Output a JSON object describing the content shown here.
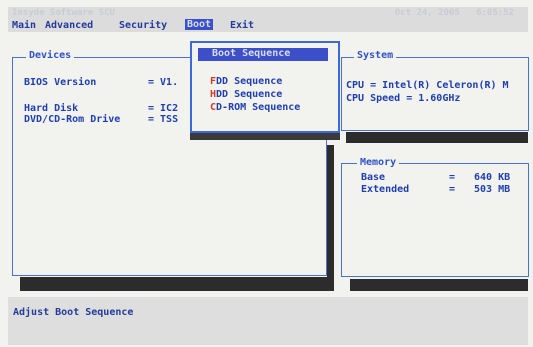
{
  "title_bar": {
    "left": "Insyde Software SCU",
    "date": "Oct 24, 2005",
    "time": "6:05:52"
  },
  "menu": [
    {
      "label": "Main"
    },
    {
      "label": "Advanced"
    },
    {
      "label": "Security"
    },
    {
      "label": "Boot",
      "active": true
    },
    {
      "label": "Exit"
    }
  ],
  "devices": {
    "title": "Devices",
    "rows": [
      {
        "label": "BIOS Version",
        "value": "= V1."
      },
      {
        "label": "Hard Disk",
        "value": "= IC2"
      },
      {
        "label": "DVD/CD-Rom Drive",
        "value": "= TSS"
      }
    ]
  },
  "boot_menu": {
    "title": "Boot Sequence",
    "items": [
      {
        "hotkey": "F",
        "rest": "DD Sequence"
      },
      {
        "hotkey": "H",
        "rest": "DD Sequence"
      },
      {
        "hotkey": "C",
        "rest": "D-ROM Sequence"
      }
    ]
  },
  "system": {
    "title": "System",
    "cpu": "CPU = Intel(R) Celeron(R) M",
    "cpu_speed": "CPU Speed = 1.60GHz"
  },
  "memory": {
    "title": "Memory",
    "base_label": "Base",
    "base_eq": "=",
    "base_value": "640 KB",
    "ext_label": "Extended",
    "ext_eq": "=",
    "ext_value": "503 MB"
  },
  "status": {
    "text": "Adjust Boot Sequence"
  },
  "colors": {
    "text": "#1f3fae",
    "accent": "#3b4fc8",
    "hotkey": "#d43a22",
    "screen": "#f2f2ef"
  }
}
